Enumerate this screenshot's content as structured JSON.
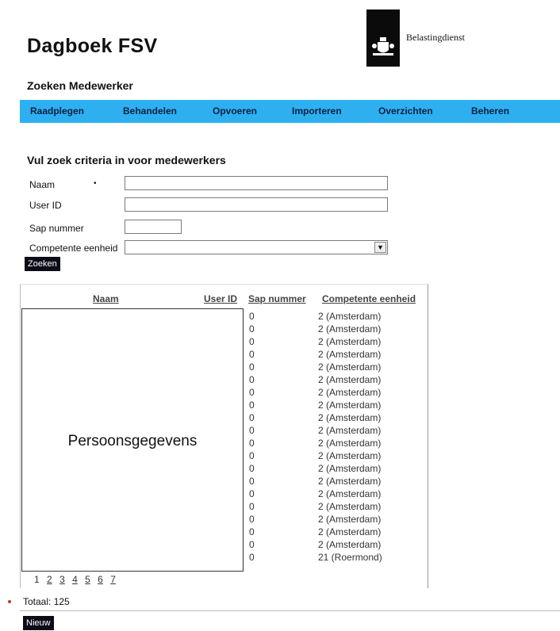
{
  "header": {
    "app_title": "Dagboek FSV",
    "logo_text": "Belastingdienst",
    "page_subtitle": "Zoeken Medewerker"
  },
  "nav": {
    "items": [
      {
        "label": "Raadplegen"
      },
      {
        "label": "Behandelen"
      },
      {
        "label": "Opvoeren"
      },
      {
        "label": "Importeren"
      },
      {
        "label": "Overzichten"
      },
      {
        "label": "Beheren"
      }
    ]
  },
  "search_form": {
    "title": "Vul zoek criteria in voor medewerkers",
    "naam_label": "Naam",
    "userid_label": "User ID",
    "sap_label": "Sap nummer",
    "eenheid_label": "Competente eenheid",
    "naam_value": "",
    "userid_value": "",
    "sap_value": "",
    "eenheid_value": "",
    "search_button": "Zoeken"
  },
  "results": {
    "columns": [
      "Naam",
      "User ID",
      "Sap nummer",
      "Competente eenheid"
    ],
    "redaction_label": "Persoonsgegevens",
    "rows": [
      {
        "sap": "0",
        "eenheid": "2 (Amsterdam)"
      },
      {
        "sap": "0",
        "eenheid": "2 (Amsterdam)"
      },
      {
        "sap": "0",
        "eenheid": "2 (Amsterdam)"
      },
      {
        "sap": "0",
        "eenheid": "2 (Amsterdam)"
      },
      {
        "sap": "0",
        "eenheid": "2 (Amsterdam)"
      },
      {
        "sap": "0",
        "eenheid": "2 (Amsterdam)"
      },
      {
        "sap": "0",
        "eenheid": "2 (Amsterdam)"
      },
      {
        "sap": "0",
        "eenheid": "2 (Amsterdam)"
      },
      {
        "sap": "0",
        "eenheid": "2 (Amsterdam)"
      },
      {
        "sap": "0",
        "eenheid": "2 (Amsterdam)"
      },
      {
        "sap": "0",
        "eenheid": "2 (Amsterdam)"
      },
      {
        "sap": "0",
        "eenheid": "2 (Amsterdam)"
      },
      {
        "sap": "0",
        "eenheid": "2 (Amsterdam)"
      },
      {
        "sap": "0",
        "eenheid": "2 (Amsterdam)"
      },
      {
        "sap": "0",
        "eenheid": "2 (Amsterdam)"
      },
      {
        "sap": "0",
        "eenheid": "2 (Amsterdam)"
      },
      {
        "sap": "0",
        "eenheid": "2 (Amsterdam)"
      },
      {
        "sap": "0",
        "eenheid": "2 (Amsterdam)"
      },
      {
        "sap": "0",
        "eenheid": "2 (Amsterdam)"
      },
      {
        "sap": "0",
        "eenheid": "21 (Roermond)"
      }
    ],
    "pages": [
      "1",
      "2",
      "3",
      "4",
      "5",
      "6",
      "7"
    ],
    "current_page": "1",
    "total": "Totaal: 125"
  },
  "footer": {
    "new_button": "Nieuw"
  },
  "colors": {
    "nav_bar": "#2eb0f0",
    "nav_text": "#0a1f44",
    "button_bg": "#0c0c18",
    "logo_bg": "#0b0b0b"
  },
  "icons": {
    "logo": "crest-icon",
    "dropdown": "chevron-down-icon"
  }
}
